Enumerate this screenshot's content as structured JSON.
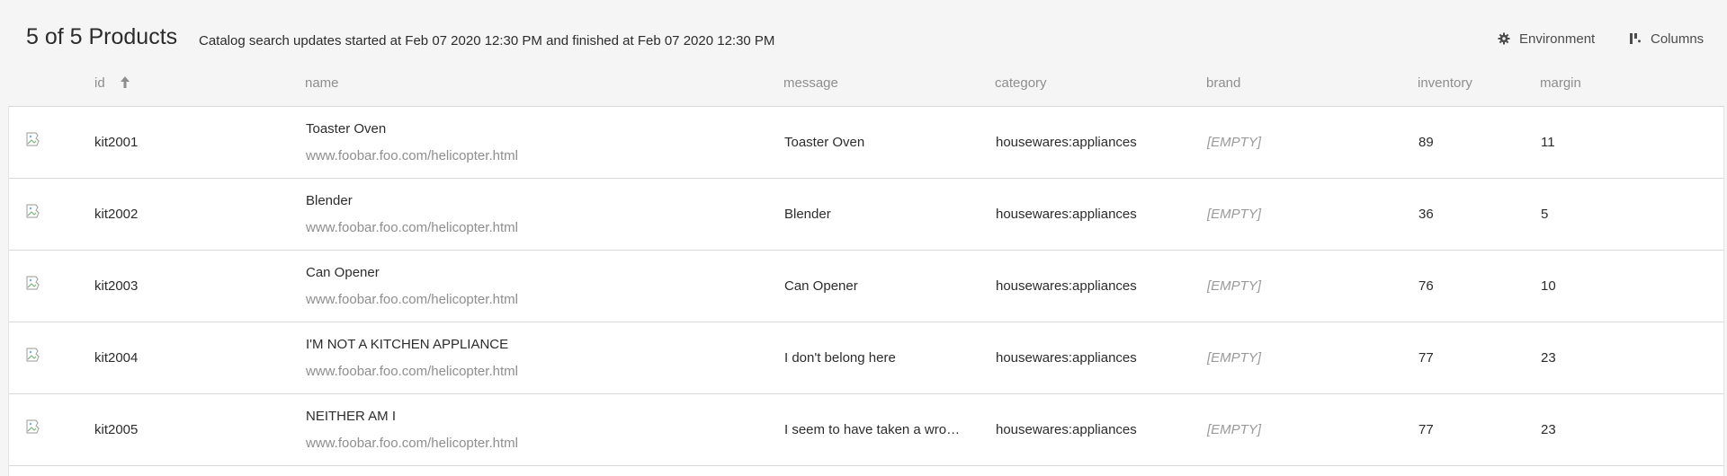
{
  "header": {
    "title": "5 of 5 Products",
    "status": "Catalog search updates started at Feb 07 2020 12:30 PM and finished at Feb 07 2020 12:30 PM",
    "environment_label": "Environment",
    "columns_label": "Columns",
    "environment_icon": "gear-icon",
    "columns_icon": "columns-icon"
  },
  "columns": {
    "id": "id",
    "name": "name",
    "message": "message",
    "category": "category",
    "brand": "brand",
    "inventory": "inventory",
    "margin": "margin",
    "sort_icon": "arrow-up-icon"
  },
  "rows": [
    {
      "id": "kit2001",
      "name": "Toaster Oven",
      "url": "www.foobar.foo.com/helicopter.html",
      "message": "Toaster Oven",
      "category": "housewares:appliances",
      "brand": "[EMPTY]",
      "inventory": "89",
      "margin": "11"
    },
    {
      "id": "kit2002",
      "name": "Blender",
      "url": "www.foobar.foo.com/helicopter.html",
      "message": "Blender",
      "category": "housewares:appliances",
      "brand": "[EMPTY]",
      "inventory": "36",
      "margin": "5"
    },
    {
      "id": "kit2003",
      "name": "Can Opener",
      "url": "www.foobar.foo.com/helicopter.html",
      "message": "Can Opener",
      "category": "housewares:appliances",
      "brand": "[EMPTY]",
      "inventory": "76",
      "margin": "10"
    },
    {
      "id": "kit2004",
      "name": "I'M NOT A KITCHEN APPLIANCE",
      "url": "www.foobar.foo.com/helicopter.html",
      "message": "I don't belong here",
      "category": "housewares:appliances",
      "brand": "[EMPTY]",
      "inventory": "77",
      "margin": "23"
    },
    {
      "id": "kit2005",
      "name": "NEITHER AM I",
      "url": "www.foobar.foo.com/helicopter.html",
      "message": "I seem to have taken a wro…",
      "category": "housewares:appliances",
      "brand": "[EMPTY]",
      "inventory": "77",
      "margin": "23"
    }
  ],
  "colors": {
    "background": "#f5f5f5",
    "table_background": "#ffffff",
    "muted_text": "#8e8e8e",
    "border": "#d9d9d9"
  }
}
